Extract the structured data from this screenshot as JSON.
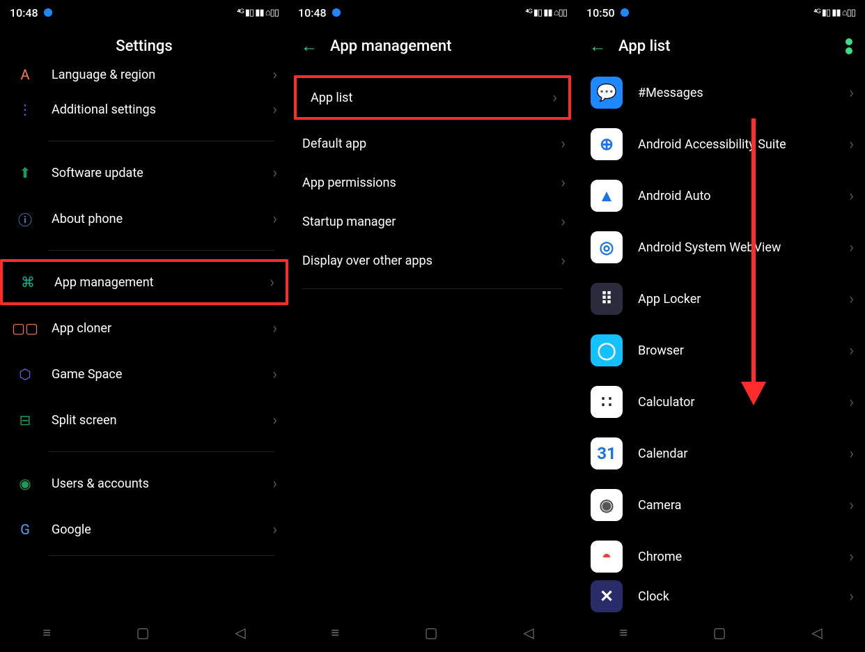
{
  "screen1": {
    "time": "10:48",
    "status_right": "⁴ᴳ  ▮▯  ▮▮  ⌂▯▯",
    "title": "Settings",
    "items": [
      {
        "label": "Language & region",
        "icon": "language-region-icon",
        "glyph": "A",
        "cls": "c-orange"
      },
      {
        "label": "Additional settings",
        "icon": "additional-settings-icon",
        "glyph": "⋮",
        "cls": "c-blue"
      },
      {
        "divider": true
      },
      {
        "label": "Software update",
        "icon": "software-update-icon",
        "glyph": "⬆",
        "cls": "c-green"
      },
      {
        "label": "About phone",
        "icon": "about-phone-icon",
        "glyph": "ⓘ",
        "cls": "c-lblue"
      },
      {
        "divider": true
      },
      {
        "label": "App management",
        "icon": "app-management-icon",
        "glyph": "⌘",
        "cls": "c-teal",
        "highlight": true
      },
      {
        "label": "App cloner",
        "icon": "app-cloner-icon",
        "glyph": "▢▢",
        "cls": "c-orange"
      },
      {
        "label": "Game Space",
        "icon": "game-space-icon",
        "glyph": "⬡",
        "cls": "c-purple"
      },
      {
        "label": "Split screen",
        "icon": "split-screen-icon",
        "glyph": "⊟",
        "cls": "c-green"
      },
      {
        "divider": true
      },
      {
        "label": "Users & accounts",
        "icon": "users-accounts-icon",
        "glyph": "◉",
        "cls": "c-green"
      },
      {
        "label": "Google",
        "icon": "google-icon",
        "glyph": "G",
        "cls": "c-lblue"
      },
      {
        "divider_thin": true
      }
    ]
  },
  "screen2": {
    "time": "10:48",
    "status_right": "⁴ᴳ  ▮▯  ▮▮  ⌂▯▯",
    "title": "App management",
    "items": [
      {
        "label": "App list",
        "highlight": true
      },
      {
        "label": "Default app"
      },
      {
        "label": "App permissions"
      },
      {
        "label": "Startup manager"
      },
      {
        "label": "Display over other apps"
      },
      {
        "divider": true
      }
    ]
  },
  "screen3": {
    "time": "10:50",
    "status_right": "⁴ᴳ  ▮▯  ▮▮  ⌂▯▯",
    "title": "App list",
    "arrow_color": "#ff2c2c",
    "apps": [
      {
        "label": "#Messages",
        "icon": "messages-icon",
        "glyph": "💬",
        "bg": "bg-blue"
      },
      {
        "label": "Android Accessibility Suite",
        "icon": "accessibility-icon",
        "glyph": "⊕",
        "bg": "bg-white",
        "fg": "#1a73e8"
      },
      {
        "label": "Android Auto",
        "icon": "android-auto-icon",
        "glyph": "▲",
        "bg": "bg-white",
        "fg": "#1a73e8"
      },
      {
        "label": "Android System WebView",
        "icon": "webview-icon",
        "glyph": "◎",
        "bg": "bg-white",
        "fg": "#1a73e8"
      },
      {
        "label": "App Locker",
        "icon": "app-locker-icon",
        "glyph": "⠿",
        "bg": "bg-dark"
      },
      {
        "label": "Browser",
        "icon": "browser-icon",
        "glyph": "◯",
        "bg": "bg-cyan"
      },
      {
        "label": "Calculator",
        "icon": "calculator-icon",
        "glyph": "∷",
        "bg": "bg-white"
      },
      {
        "label": "Calendar",
        "icon": "calendar-icon",
        "glyph": "31",
        "bg": "bg-white",
        "fg": "#1a73e8"
      },
      {
        "label": "Camera",
        "icon": "camera-icon",
        "glyph": "◉",
        "bg": "bg-white",
        "fg": "#555"
      },
      {
        "label": "Chrome",
        "icon": "chrome-icon",
        "glyph": "◓",
        "bg": "bg-white",
        "fg": "#ea4335"
      },
      {
        "label": "Clock",
        "icon": "clock-icon",
        "glyph": "✕",
        "bg": "bg-navy"
      }
    ]
  }
}
